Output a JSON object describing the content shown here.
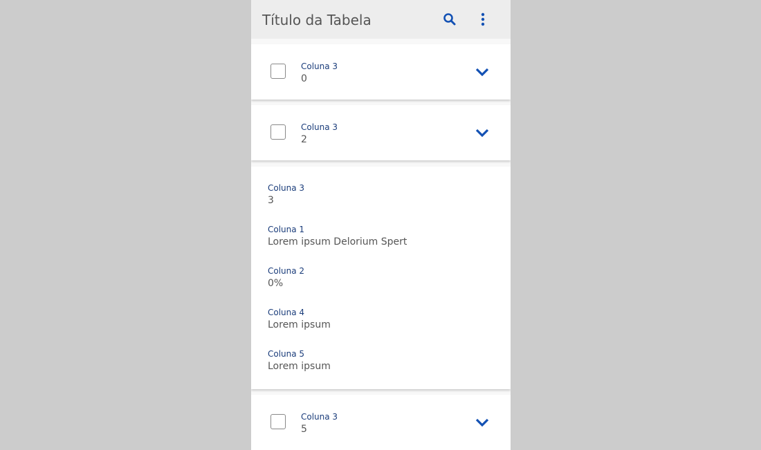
{
  "header": {
    "title": "Título da Tabela",
    "icons": [
      "search-icon",
      "more-vertical-icon"
    ]
  },
  "accent": "#1351b4",
  "rows": [
    {
      "label": "Coluna 3",
      "value": "0"
    },
    {
      "label": "Coluna 3",
      "value": "2"
    },
    {
      "label": "Coluna 3",
      "value": "5"
    }
  ],
  "expanded": {
    "fields": [
      {
        "label": "Coluna 3",
        "value": "3"
      },
      {
        "label": "Coluna 1",
        "value": "Lorem ipsum Delorium Spert"
      },
      {
        "label": "Coluna 2",
        "value": "0%"
      },
      {
        "label": "Coluna 4",
        "value": "Lorem ipsum"
      },
      {
        "label": "Coluna 5",
        "value": "Lorem ipsum"
      }
    ]
  }
}
